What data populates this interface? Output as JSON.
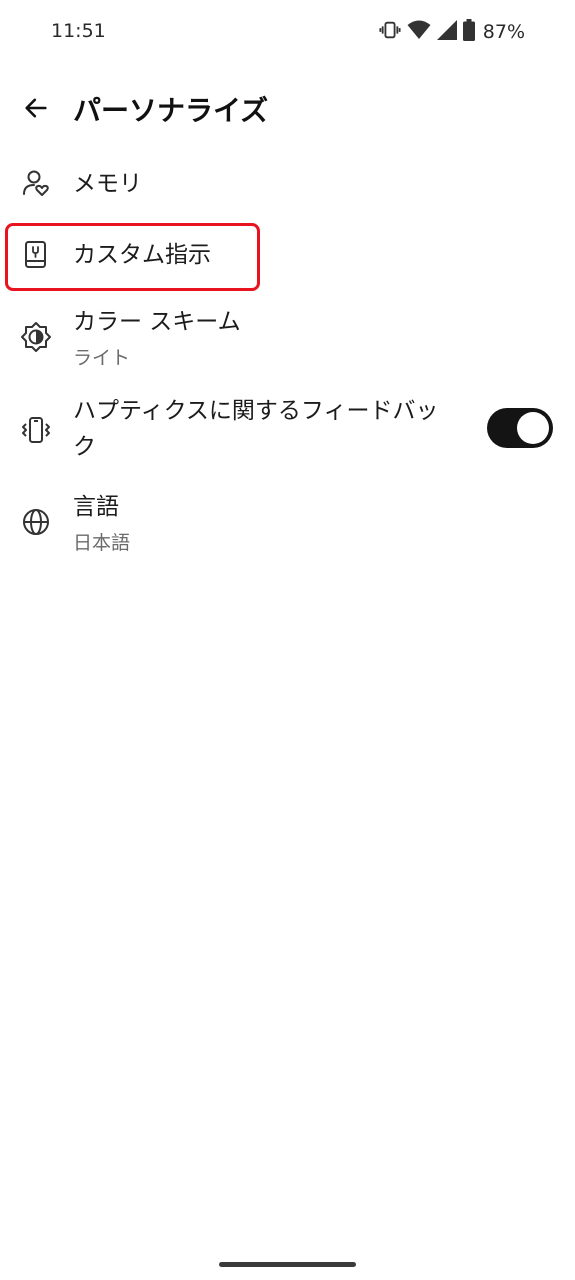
{
  "status_bar": {
    "time": "11:51",
    "battery_percent": "87%",
    "icons": [
      "vibrate-icon",
      "wifi-icon",
      "signal-icon",
      "battery-icon"
    ]
  },
  "app_bar": {
    "title": "パーソナライズ",
    "back_icon": "arrow-left-icon"
  },
  "settings": {
    "memory": {
      "title": "メモリ",
      "icon": "person-heart-icon"
    },
    "custom_instructions": {
      "title": "カスタム指示",
      "icon": "book-icon",
      "highlighted": true
    },
    "color_scheme": {
      "title": "カラー スキーム",
      "subtitle": "ライト",
      "icon": "brightness-icon"
    },
    "haptics": {
      "title_line1": "ハプティクスに関するフィードバッ",
      "title_line2": "ク",
      "icon": "phone-vibrate-icon",
      "toggle_on": true
    },
    "language": {
      "title": "言語",
      "subtitle": "日本語",
      "icon": "globe-icon"
    }
  },
  "colors": {
    "highlight": "#e8131f",
    "toggle_track": "#141414",
    "toggle_knob": "#ffffff"
  }
}
